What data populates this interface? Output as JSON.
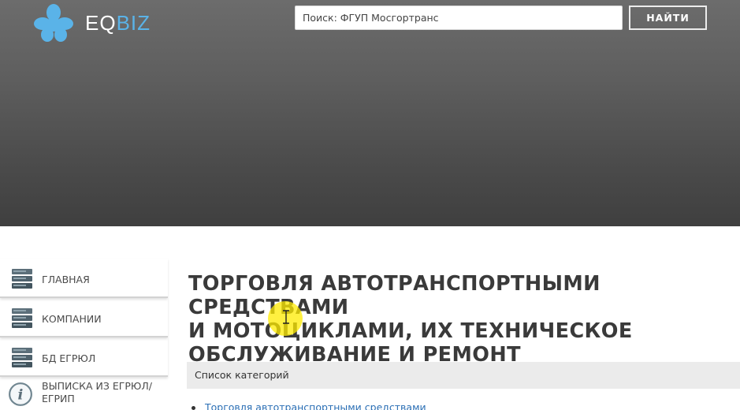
{
  "header": {
    "logo": {
      "part1": "EQ",
      "part2": "BIZ"
    },
    "search": {
      "value": "Поиск: ФГУП Мосгортранс"
    },
    "search_button_label": "НАЙТИ"
  },
  "sidebar": {
    "items": [
      {
        "label": "ГЛАВНАЯ",
        "icon": "server-stack-icon"
      },
      {
        "label": "КОМПАНИИ",
        "icon": "server-stack-icon"
      },
      {
        "label": "БД ЕГРЮЛ",
        "icon": "server-stack-icon"
      },
      {
        "label_line1": "ВЫПИСКА ИЗ ЕГРЮЛ/",
        "label_line2": "ЕГРИП",
        "icon": "info-icon"
      }
    ]
  },
  "main": {
    "title_line1": "ТОРГОВЛЯ АВТОТРАНСПОРТНЫМИ СРЕДСТВАМИ",
    "title_line2": "И МОТОЦИКЛАМИ, ИХ ТЕХНИЧЕСКОЕ",
    "title_line3": "ОБСЛУЖИВАНИЕ И РЕМОНТ",
    "categories_label": "Список категорий",
    "categories": [
      "Торговля автотранспортными средствами"
    ]
  },
  "colors": {
    "header_top": "#6c6c6c",
    "header_bottom": "#3f3f3f",
    "logo_blue": "#5ab3e8",
    "link": "#2b6fb5",
    "cursor_highlight": "#ffeb00"
  }
}
